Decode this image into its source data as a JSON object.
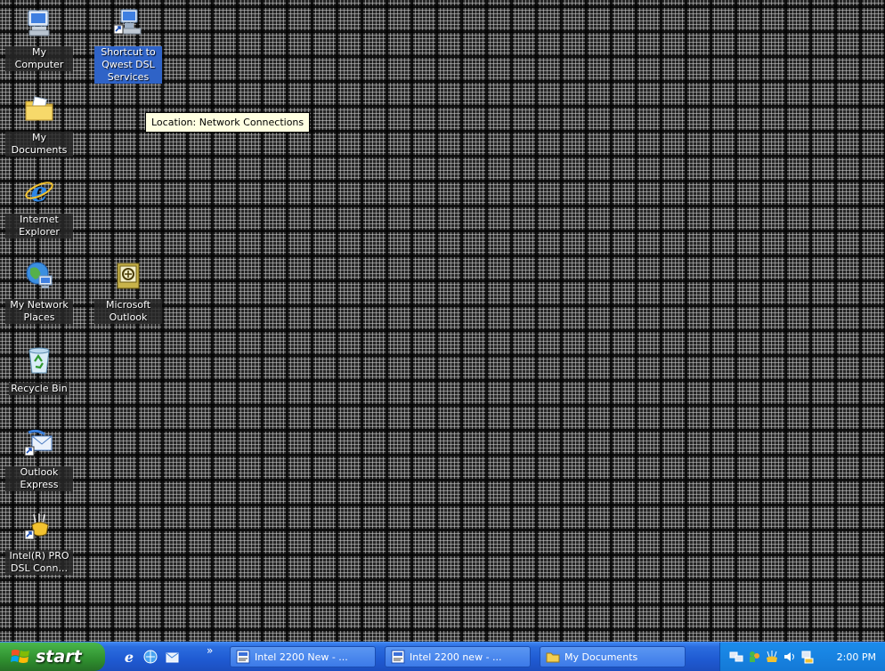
{
  "desktop": {
    "icons": [
      {
        "label": "My Computer",
        "icon": "my-computer-icon"
      },
      {
        "label": "Shortcut to Qwest DSL Services",
        "icon": "network-shortcut-icon",
        "selected": true
      },
      {
        "label": "My Documents",
        "icon": "my-documents-icon"
      },
      {
        "label": "Internet Explorer",
        "icon": "internet-explorer-icon"
      },
      {
        "label": "My Network Places",
        "icon": "my-network-places-icon"
      },
      {
        "label": "Microsoft Outlook",
        "icon": "outlook-icon"
      },
      {
        "label": "Recycle Bin",
        "icon": "recycle-bin-icon"
      },
      {
        "label": "Outlook Express",
        "icon": "outlook-express-icon"
      },
      {
        "label": "Intel(R) PRO DSL Conn...",
        "icon": "intel-dsl-icon"
      }
    ],
    "tooltip": "Location: Network Connections"
  },
  "taskbar": {
    "start_label": "start",
    "quick_launch": [
      "internet-explorer-icon",
      "browser-icon",
      "outlook-express-icon"
    ],
    "overflow": "»",
    "tasks": [
      {
        "label": "Intel 2200 New - ...",
        "icon": "word-doc-icon"
      },
      {
        "label": "Intel 2200 new - ...",
        "icon": "word-doc-icon"
      },
      {
        "label": "My Documents",
        "icon": "folder-icon"
      }
    ],
    "tray_icons": [
      "network-icon",
      "messenger-icon",
      "tray-app-icon",
      "volume-icon",
      "connection-icon"
    ],
    "clock": "2:00 PM"
  },
  "colors": {
    "taskbar": "#1f5ad2",
    "start": "#3a9e3a",
    "selection": "#2f63c7",
    "tooltip_bg": "#ffffe1"
  }
}
